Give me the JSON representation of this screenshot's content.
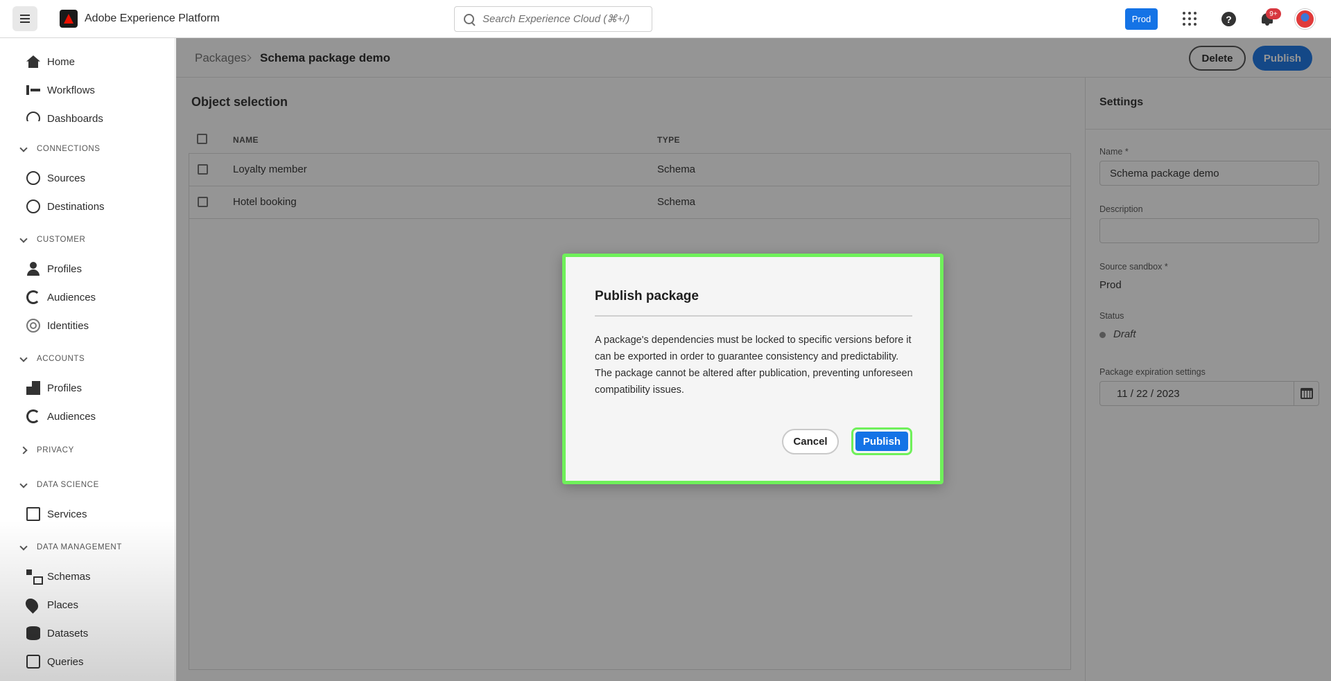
{
  "topbar": {
    "app_name": "Adobe Experience Platform",
    "search_placeholder": "Search Experience Cloud (⌘+/)",
    "sandbox_label": "Prod",
    "notification_count": "9+"
  },
  "sidebar": {
    "top_items": [
      {
        "label": "Home",
        "icon": "home-icon"
      },
      {
        "label": "Workflows",
        "icon": "workflows-icon"
      },
      {
        "label": "Dashboards",
        "icon": "dashboards-icon"
      }
    ],
    "sections": {
      "connections": {
        "label": "CONNECTIONS",
        "items": [
          {
            "label": "Sources"
          },
          {
            "label": "Destinations"
          }
        ]
      },
      "customer": {
        "label": "CUSTOMER",
        "items": [
          {
            "label": "Profiles"
          },
          {
            "label": "Audiences"
          },
          {
            "label": "Identities"
          }
        ]
      },
      "accounts": {
        "label": "ACCOUNTS",
        "items": [
          {
            "label": "Profiles"
          },
          {
            "label": "Audiences"
          }
        ]
      },
      "privacy": {
        "label": "PRIVACY"
      },
      "data_science": {
        "label": "DATA SCIENCE",
        "items": [
          {
            "label": "Services"
          }
        ]
      },
      "data_management": {
        "label": "DATA MANAGEMENT",
        "items": [
          {
            "label": "Schemas"
          },
          {
            "label": "Places"
          },
          {
            "label": "Datasets"
          },
          {
            "label": "Queries"
          }
        ]
      }
    }
  },
  "header": {
    "breadcrumb_root": "Packages",
    "breadcrumb_current": "Schema package demo",
    "delete_label": "Delete",
    "publish_label": "Publish"
  },
  "objects": {
    "title": "Object selection",
    "columns": {
      "name": "NAME",
      "type": "TYPE"
    },
    "rows": [
      {
        "name": "Loyalty member",
        "type": "Schema"
      },
      {
        "name": "Hotel booking",
        "type": "Schema"
      }
    ]
  },
  "settings": {
    "title": "Settings",
    "name_label": "Name",
    "name_value": "Schema package demo",
    "description_label": "Description",
    "description_value": "",
    "sandbox_label": "Source sandbox",
    "sandbox_value": "Prod",
    "status_label": "Status",
    "status_value": "Draft",
    "expiration_label": "Package expiration settings",
    "expiration_value": "11 / 22 / 2023",
    "required_mark": "*"
  },
  "modal": {
    "title": "Publish package",
    "body": "A package's dependencies must be locked to specific versions before it can be exported in order to guarantee consistency and predictability. The package cannot be altered after publication, preventing unforeseen compatibility issues.",
    "cancel_label": "Cancel",
    "publish_label": "Publish"
  },
  "colors": {
    "accent": "#1473e6",
    "highlight": "#6ff05a",
    "badge": "#d7373f"
  }
}
